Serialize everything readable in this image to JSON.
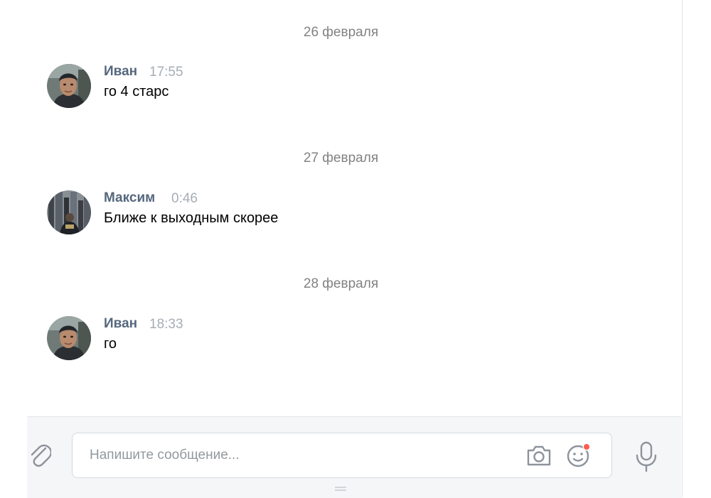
{
  "messages_history": [
    {
      "date": "26 февраля",
      "author": "Иван",
      "time": "17:55",
      "text": "го 4 старс"
    },
    {
      "date": "27 февраля",
      "author": "Максим",
      "time": "0:46",
      "text": "Ближе к выходным скорее"
    },
    {
      "date": "28 февраля",
      "author": "Иван",
      "time": "18:33",
      "text": "го"
    }
  ],
  "composer": {
    "placeholder": "Напишите сообщение...",
    "icons": {
      "attach": "paperclip-icon",
      "camera": "camera-icon",
      "emoji": "smiley-icon",
      "mic": "microphone-icon"
    },
    "emoji_badge_color": "#ff5c4d"
  },
  "colors": {
    "author_name": "#55677d",
    "timestamp": "#a6adb5",
    "date_separator": "#828282",
    "icon": "#8d939b"
  }
}
